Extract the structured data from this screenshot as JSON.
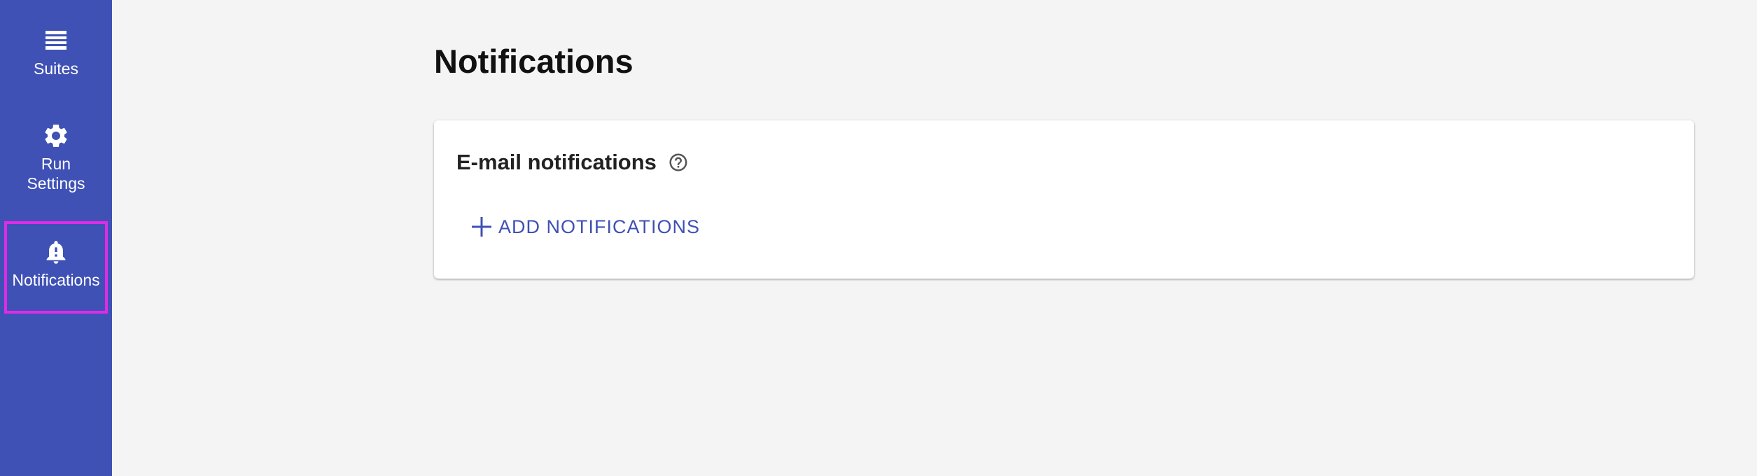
{
  "sidebar": {
    "background_color": "#3f51b5",
    "items": [
      {
        "label": "Suites",
        "icon": "list-icon",
        "selected": false
      },
      {
        "label": "Run\nSettings",
        "icon": "gear-icon",
        "selected": false
      },
      {
        "label": "Notifications",
        "icon": "bell-alert-icon",
        "selected": true
      }
    ],
    "selected_outline_color": "#e02be6"
  },
  "main": {
    "page_title": "Notifications",
    "card": {
      "title": "E-mail notifications",
      "help_icon": "help-circle-icon",
      "add_button_label": "ADD NOTIFICATIONS",
      "add_button_icon": "plus-icon",
      "accent_color": "#3f51b5"
    }
  }
}
